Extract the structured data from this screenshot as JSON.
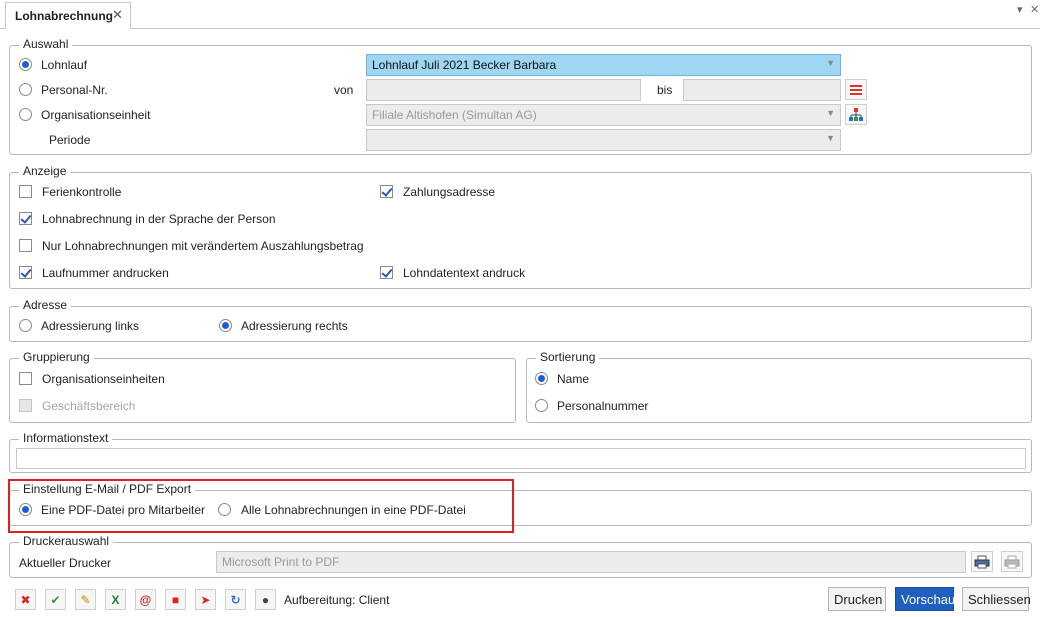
{
  "tab": {
    "title": "Lohnabrechnung",
    "close": "✕"
  },
  "window_controls": {
    "pin": "▾",
    "close": "✕"
  },
  "auswahl": {
    "legend": "Auswahl",
    "lohnlauf_label": "Lohnlauf",
    "lohnlauf_value": "Lohnlauf Juli 2021 Becker Barbara",
    "personal_label": "Personal-Nr.",
    "von_label": "von",
    "bis_label": "bis",
    "org_label": "Organisationseinheit",
    "org_value": "Filiale Altishofen (Simultan AG)",
    "periode_label": "Periode"
  },
  "anzeige": {
    "legend": "Anzeige",
    "ferienkontrolle": "Ferienkontrolle",
    "zahlungsadresse": "Zahlungsadresse",
    "sprache": "Lohnabrechnung in der Sprache der Person",
    "nur_veraendert": "Nur Lohnabrechnungen mit verändertem Auszahlungsbetrag",
    "laufnummer": "Laufnummer andrucken",
    "lohndatentext": "Lohndatentext andruck"
  },
  "adresse": {
    "legend": "Adresse",
    "links": "Adressierung links",
    "rechts": "Adressierung rechts"
  },
  "gruppierung": {
    "legend": "Gruppierung",
    "org": "Organisationseinheiten",
    "geschaeft": "Geschäftsbereich"
  },
  "sortierung": {
    "legend": "Sortierung",
    "name": "Name",
    "personalnummer": "Personalnummer"
  },
  "informationstext": {
    "legend": "Informationstext",
    "value": ""
  },
  "export": {
    "legend": "Einstellung E-Mail / PDF Export",
    "pro_mitarbeiter": "Eine PDF-Datei pro Mitarbeiter",
    "alle": "Alle Lohnabrechnungen in eine PDF-Datei"
  },
  "drucker": {
    "legend": "Druckerauswahl",
    "label": "Aktueller Drucker",
    "value": "Microsoft Print to PDF"
  },
  "footer": {
    "status": "Aufbereitung: Client",
    "drucken": "Drucken",
    "vorschau": "Vorschau",
    "schliessen": "Schliessen"
  },
  "colors": {
    "accent": "#1f5fbf",
    "selected_field": "#9fd6f4",
    "highlight_border": "#e02020"
  }
}
